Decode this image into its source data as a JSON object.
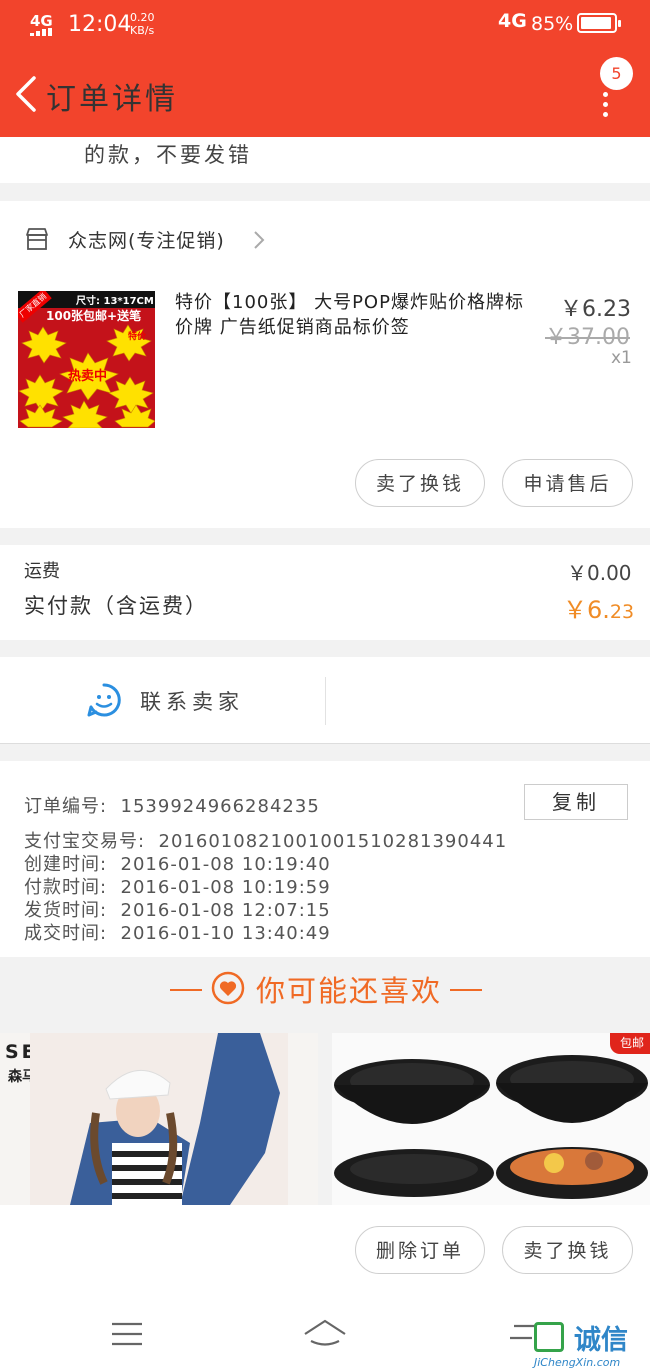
{
  "status_bar": {
    "network": "4G",
    "time": "12:04",
    "speed_value": "0.20",
    "speed_unit": "KB/s",
    "signal": "4G",
    "battery": "85%",
    "battery_level": 0.85
  },
  "header": {
    "title": "订单详情",
    "badge_count": "5"
  },
  "note_text": "的款，不要发错",
  "shop": {
    "name": "众志网(专注促销)"
  },
  "product": {
    "title": "特价【100张】 大号POP爆炸贴价格牌标价牌 广告纸促销商品标价签",
    "price": "￥6.23",
    "original_price": "￥37.00",
    "quantity": "x1",
    "image_texts": {
      "size": "尺寸: 13*17CM",
      "promo": "100张包邮+送笔",
      "corner": "厂家直销",
      "hot": "热卖中",
      "special": "特价"
    }
  },
  "item_actions": {
    "sell_label": "卖了换钱",
    "after_sale_label": "申请售后"
  },
  "fees": {
    "shipping_label": "运费",
    "shipping_value": "￥0.00",
    "paid_label": "实付款（含运费）",
    "paid_currency": "￥",
    "paid_int": "6.",
    "paid_dec": "23"
  },
  "contact": {
    "label": "联系卖家"
  },
  "order_info": {
    "order_no_label": "订单编号:",
    "order_no": "1539924966284235",
    "copy_label": "复制",
    "alipay_label": "支付宝交易号:",
    "alipay_no": "2016010821001001510281390441",
    "created_label": "创建时间:",
    "created": "2016-01-08 10:19:40",
    "paid_label": "付款时间:",
    "paid": "2016-01-08 10:19:59",
    "shipped_label": "发货时间:",
    "shipped": "2016-01-08 12:07:15",
    "done_label": "成交时间:",
    "done": "2016-01-10 13:40:49"
  },
  "recommend": {
    "title": "你可能还喜欢",
    "item1_brand": "SEMIR",
    "item1_brand_cn": "森马",
    "item2_tag": "包邮"
  },
  "bottom_actions": {
    "delete_label": "删除订单",
    "sell_label": "卖了换钱"
  },
  "watermark": {
    "cn": "诚信",
    "url": "JiChengXin.com"
  },
  "colors": {
    "header": "#f2442c",
    "accent": "#f06a25",
    "price_paid": "#f08c26"
  }
}
